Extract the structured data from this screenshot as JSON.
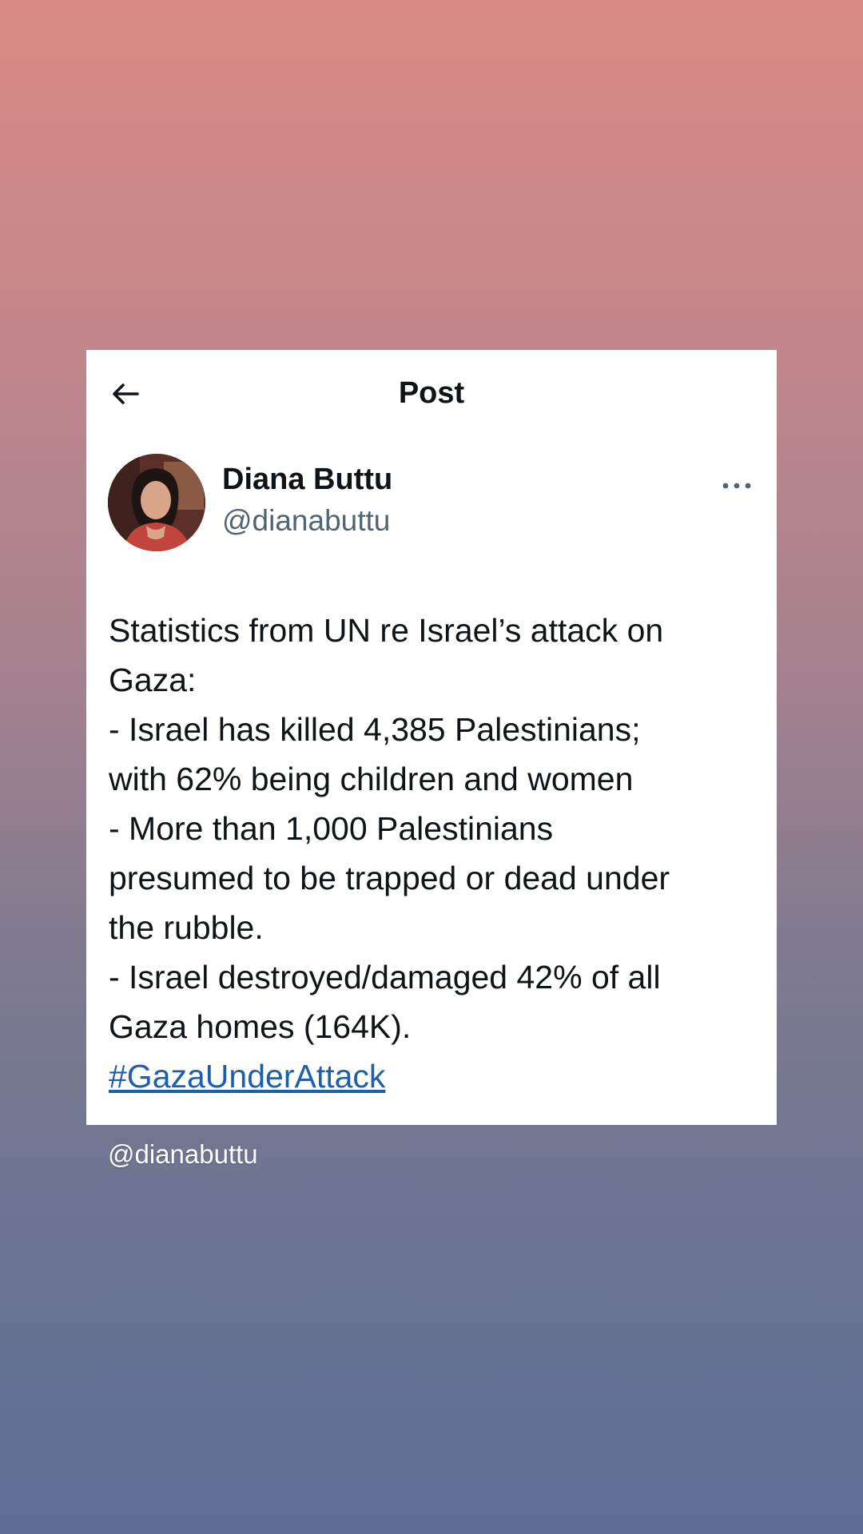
{
  "header": {
    "title": "Post",
    "back_icon": "arrow-left-icon"
  },
  "author": {
    "name": "Diana Buttu",
    "handle": "@dianabuttu",
    "more_icon": "more-options-icon"
  },
  "post": {
    "lines": [
      "Statistics from UN re Israel’s attack on",
      "Gaza:",
      "- Israel has killed 4,385 Palestinians;",
      "with 62% being children and women",
      "- More than 1,000 Palestinians",
      "presumed to be trapped or dead under",
      "the rubble.",
      "- Israel destroyed/damaged 42% of all",
      "Gaza homes (164K)."
    ],
    "hashtag": "#GazaUnderAttack"
  },
  "caption": "@dianabuttu",
  "colors": {
    "hashtag": "#1d5fa8",
    "text": "#0f1419",
    "handle": "#536471",
    "gradient_top": "#d98a84",
    "gradient_bottom": "#5d6d95"
  }
}
